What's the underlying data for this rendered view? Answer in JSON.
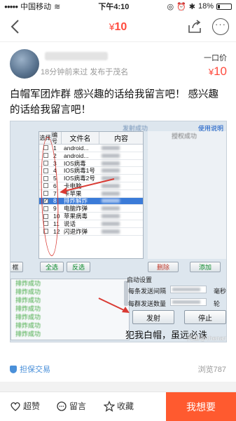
{
  "status_bar": {
    "carrier": "中国移动",
    "time": "下午4:10",
    "battery": "18%"
  },
  "nav": {
    "price_symbol": "¥",
    "price": "10"
  },
  "seller": {
    "meta": "18分钟前来过  发布于茂名",
    "price_label": "一口价",
    "price_symbol": "¥",
    "price": "10"
  },
  "description": "白帽军团炸群 感兴趣的话给我留言吧！ 感兴趣的话给我留言吧！",
  "image": {
    "top_status": "发射成功",
    "top_link": "使用说明",
    "columns": [
      "选择",
      "编号",
      "文件名",
      "内容"
    ],
    "rows": [
      {
        "num": "1",
        "name": "android...",
        "checked": false
      },
      {
        "num": "2",
        "name": "android...",
        "checked": false
      },
      {
        "num": "3",
        "name": "IOS病毒",
        "checked": false
      },
      {
        "num": "4",
        "name": "IOS病毒1号",
        "checked": false
      },
      {
        "num": "5",
        "name": "IOS病毒2号",
        "checked": false
      },
      {
        "num": "6",
        "name": "卡电脑",
        "checked": false
      },
      {
        "num": "7",
        "name": "卡苹果",
        "checked": false
      },
      {
        "num": "8",
        "name": "排炸解炸",
        "checked": true
      },
      {
        "num": "9",
        "name": "电脑炸弹",
        "checked": false
      },
      {
        "num": "10",
        "name": "苹果病毒",
        "checked": false
      },
      {
        "num": "11",
        "name": "说话",
        "checked": false
      },
      {
        "num": "12",
        "name": "闪退炸弹",
        "checked": false
      }
    ],
    "right_header": "授权成功",
    "btn_select_all": "全选",
    "btn_invert": "反选",
    "btn_delete": "删除",
    "btn_add": "添加",
    "log_lines": [
      "排炸成功",
      "排炸成功",
      "排炸成功",
      "排炸成功",
      "排炸成功",
      "排炸成功",
      "排炸成功"
    ],
    "settings_title": "启动设置",
    "interval_label": "每条发送间隔",
    "interval_unit": "毫秒",
    "count_label": "每群发送数量",
    "count_unit": "轮",
    "fire": "发射",
    "stop": "停止",
    "slogan": "犯我白帽，虽远必诛",
    "watermark": "闲鱼@chenan93"
  },
  "guarantee": "担保交易",
  "views": "浏览787",
  "bottom_bar": {
    "like": "超赞",
    "comment": "留言",
    "favorite": "收藏",
    "want": "我想要"
  },
  "colors": {
    "accent": "#ff4a3d",
    "want_button": "#ff5a2f",
    "guarantee": "#4a90d9"
  }
}
